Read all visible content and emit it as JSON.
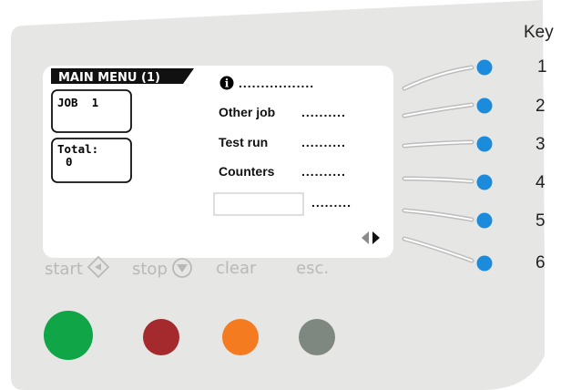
{
  "display": {
    "header": "MAIN MENU (1)",
    "job_box": "JOB  1",
    "total_box_label": "Total:",
    "total_box_value": "0",
    "info_icon": "info-icon",
    "menu_items": [
      "Other job",
      "Test run",
      "Counters"
    ],
    "dots": ".................",
    "dots_short": "..........",
    "dots_input": ".........",
    "nav_icon": "left-right-arrows-icon"
  },
  "key": {
    "title": "Key",
    "numbers": [
      "1",
      "2",
      "3",
      "4",
      "5",
      "6"
    ]
  },
  "buttons": {
    "start": "start",
    "stop": "stop",
    "clear": "clear",
    "esc": "esc."
  },
  "colors": {
    "panel": "#e6e7e5",
    "led": "#1d8bdc",
    "start_button": "#10a547",
    "stop_button": "#a52a2d",
    "clear_button": "#f47b20",
    "esc_button": "#7f8880"
  }
}
